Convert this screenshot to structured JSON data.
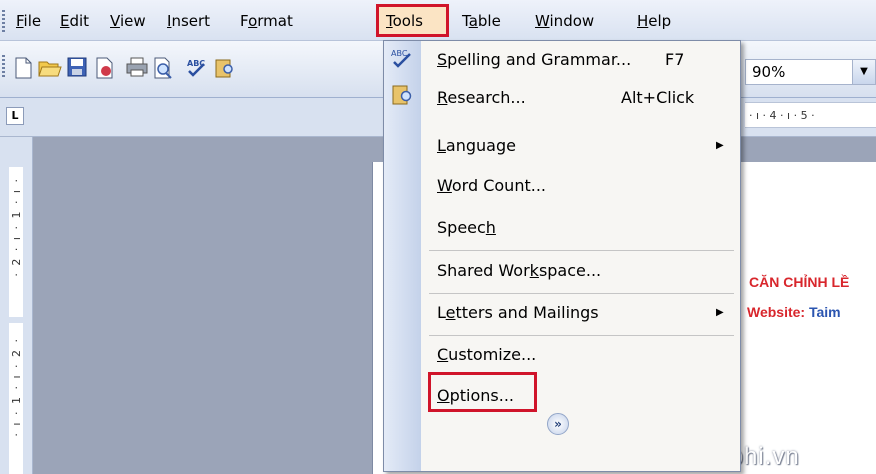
{
  "menubar": {
    "items": [
      {
        "pre": "",
        "u": "F",
        "post": "ile"
      },
      {
        "pre": "",
        "u": "E",
        "post": "dit"
      },
      {
        "pre": "",
        "u": "V",
        "post": "iew"
      },
      {
        "pre": "",
        "u": "I",
        "post": "nsert"
      },
      {
        "pre": "F",
        "u": "o",
        "post": "rmat"
      },
      {
        "pre": "",
        "u": "T",
        "post": "ools"
      },
      {
        "pre": "T",
        "u": "a",
        "post": "ble"
      },
      {
        "pre": "",
        "u": "W",
        "post": "indow"
      },
      {
        "pre": "",
        "u": "H",
        "post": "elp"
      }
    ],
    "highlight_color": "#d0142a"
  },
  "toolbar": {
    "icons": [
      "new-document-icon",
      "open-folder-icon",
      "save-icon",
      "permission-icon",
      "print-icon",
      "print-preview-icon",
      "spelling-icon",
      "research-icon"
    ],
    "zoom_value": "90%"
  },
  "ruler": {
    "tab_stop_glyph": "L",
    "horizontal_marks": "· ı · 4 · ı · 5 ·",
    "vertical_upper": "· 2 · ı · 1 · ı ·",
    "vertical_lower": "· ı · 1 · ı · 2 ·"
  },
  "tools_menu": {
    "items": [
      {
        "pre": "",
        "u": "S",
        "post": "pelling and Grammar...",
        "shortcut": "F7",
        "icon": "spelling-abc-icon"
      },
      {
        "pre": "",
        "u": "R",
        "post": "esearch...",
        "shortcut": "Alt+Click",
        "icon": "research-book-icon"
      },
      {
        "pre": "",
        "u": "L",
        "post": "anguage",
        "submenu": true
      },
      {
        "pre": "",
        "u": "W",
        "post": "ord Count..."
      },
      {
        "pre": "Speec",
        "u": "h",
        "post": ""
      },
      {
        "pre": "Shared Wor",
        "u": "k",
        "post": "space..."
      },
      {
        "pre": "L",
        "u": "e",
        "post": "tters and Mailings",
        "submenu": true
      },
      {
        "pre": "",
        "u": "C",
        "post": "ustomize..."
      },
      {
        "pre": "",
        "u": "O",
        "post": "ptions..."
      }
    ],
    "expand_glyph": "»"
  },
  "document": {
    "line1": "CĂN CHỈNH LỀ",
    "line2_label": "Website: ",
    "line2_value": "Taim",
    "red": "#d8262c",
    "blue": "#2b55b0"
  },
  "watermark": "Taimienphi.vn"
}
